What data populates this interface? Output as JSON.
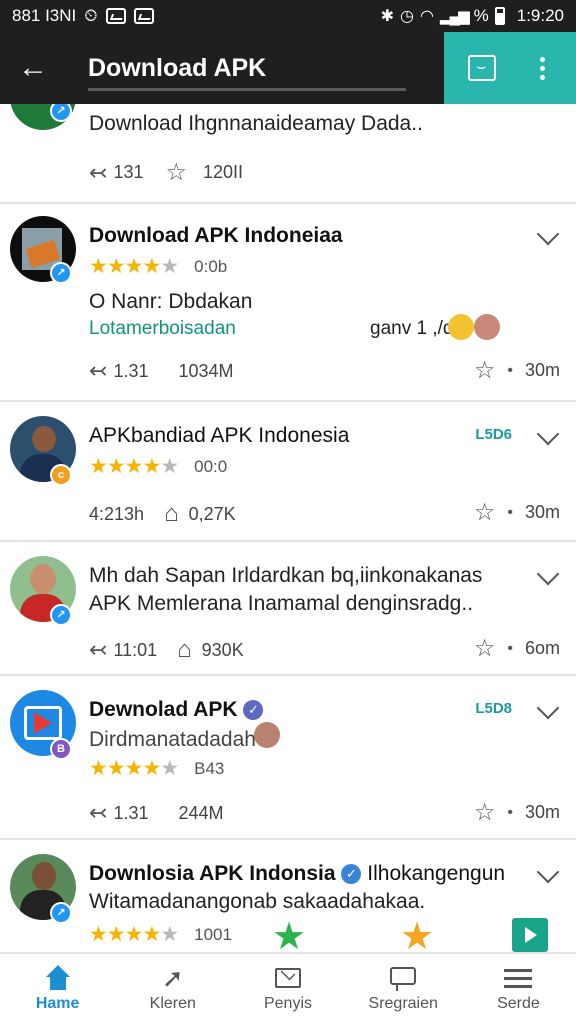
{
  "status_bar": {
    "left_text": "881 I3NI",
    "time": "1:9:20",
    "percent": "%"
  },
  "header": {
    "title": "Download APK"
  },
  "items": [
    {
      "line1": "Download Ihgnnanaideamay Dada..",
      "reply_count": "131",
      "star_count": "120II"
    },
    {
      "title": "Download APK Indoneiaa",
      "rating": 4,
      "rating_text": "0:0b",
      "line1": "O Nanr: Dbdakan",
      "link": "Lotamerboisadan",
      "extra": "ganv 1 ,/d",
      "reply_count": "1.31",
      "star_count": "1034M",
      "time": "30m"
    },
    {
      "title": "APKbandiad APK Indonesia",
      "tag": "L5D6",
      "rating": 4,
      "rating_text": "00:0",
      "reply_count": "4:213h",
      "star_count": "0,27K",
      "time": "30m"
    },
    {
      "line1": "Mh dah Sapan Irldardkan bq,iinkonakanas",
      "line2": "APK Memlerana Inamamal denginsradg..",
      "reply_count": "11:01",
      "star_count": "930K",
      "time": "6om"
    },
    {
      "title": "Dewnolad APK",
      "tag": "L5D8",
      "line1": "Dirdmanatadadah",
      "rating": 4,
      "rating_text": "B43",
      "reply_count": "1.31",
      "star_count": "244M",
      "time": "30m"
    },
    {
      "title": "Downlosia APK Indonsia",
      "title_suffix": "Ilhokangengun",
      "line1": "Witamadanangonab sakaadahakaa.",
      "rating": 4,
      "rating_text": "1001"
    }
  ],
  "bottom_nav": [
    {
      "label": "Hame",
      "icon": "home-icon",
      "active": true
    },
    {
      "label": "Kleren",
      "icon": "share-icon",
      "active": false
    },
    {
      "label": "Penyis",
      "icon": "mail-icon",
      "active": false
    },
    {
      "label": "Sregraien",
      "icon": "message-icon",
      "active": false
    },
    {
      "label": "Serde",
      "icon": "menu-icon",
      "active": false
    }
  ],
  "colors": {
    "accent": "#2ab6ad",
    "bar": "#1f1f1f",
    "star": "#f6b400",
    "link": "#12937f",
    "active_nav": "#1b8fd0"
  }
}
